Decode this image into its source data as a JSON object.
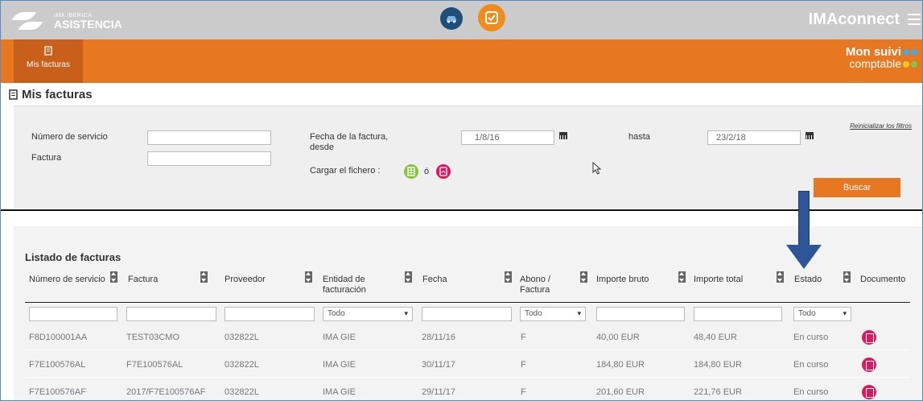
{
  "header": {
    "logo_sub": "IMA IBERICA",
    "logo_main": "ASISTENCIA",
    "brand_prefix": "IMA",
    "brand_suffix": "connect"
  },
  "nav": {
    "active_label": "Mis facturas",
    "suivi_line1": "Mon suivi",
    "suivi_line2": "comptable"
  },
  "page": {
    "title": "Mis facturas"
  },
  "filters": {
    "numero_servicio_label": "Número de servicio",
    "numero_servicio_value": "",
    "factura_label": "Factura",
    "factura_value": "",
    "fecha_desde_label_1": "Fecha de la factura,",
    "fecha_desde_label_2": "desde",
    "fecha_desde_value": "1/8/16",
    "hasta_label": "hasta",
    "hasta_value": "23/2/18",
    "cargar_label": "Cargar el fichero :",
    "or_label": "ó",
    "reset_label": "Reinicializar los filtros",
    "search_button": "Buscar"
  },
  "list": {
    "title": "Listado de facturas",
    "columns": [
      "Número de servicio",
      "Factura",
      "Proveedor",
      "Entidad de facturación",
      "Fecha",
      "Abono / Factura",
      "Importe bruto",
      "Importe total",
      "Estado",
      "Documento"
    ],
    "col_entidad_1": "Entidad de",
    "col_entidad_2": "facturación",
    "col_abono_1": "Abono /",
    "col_abono_2": "Factura",
    "filter_select_value": "Todo",
    "rows": [
      {
        "servicio": "F8D100001AA",
        "factura": "TEST03CMO",
        "proveedor": "032822L",
        "entidad": "IMA GIE",
        "fecha": "28/11/16",
        "abono": "F",
        "bruto": "40,00 EUR",
        "total": "48,40 EUR",
        "estado": "En curso"
      },
      {
        "servicio": "F7E100576AL",
        "factura": "F7E100576AL",
        "proveedor": "032822L",
        "entidad": "IMA GIE",
        "fecha": "30/11/17",
        "abono": "F",
        "bruto": "184,80 EUR",
        "total": "184,80 EUR",
        "estado": "En curso"
      },
      {
        "servicio": "F7E100576AF",
        "factura": "2017/F7E100576AF",
        "proveedor": "032822L",
        "entidad": "IMA GIE",
        "fecha": "29/11/17",
        "abono": "F",
        "bruto": "201,60 EUR",
        "total": "221,76 EUR",
        "estado": "En curso"
      }
    ]
  },
  "colors": {
    "orange": "#e87722",
    "orange_dark": "#c85f1a",
    "topbar": "#cbcbcb",
    "pdf_red": "#d81b60",
    "upload_green": "#86c440",
    "arrow_blue": "#2e5597"
  },
  "icons": {
    "car": "car-icon",
    "check": "check-document-icon",
    "menu": "hamburger-menu-icon",
    "calendar": "calendar-icon",
    "pdf": "pdf-icon",
    "excel": "spreadsheet-icon"
  }
}
